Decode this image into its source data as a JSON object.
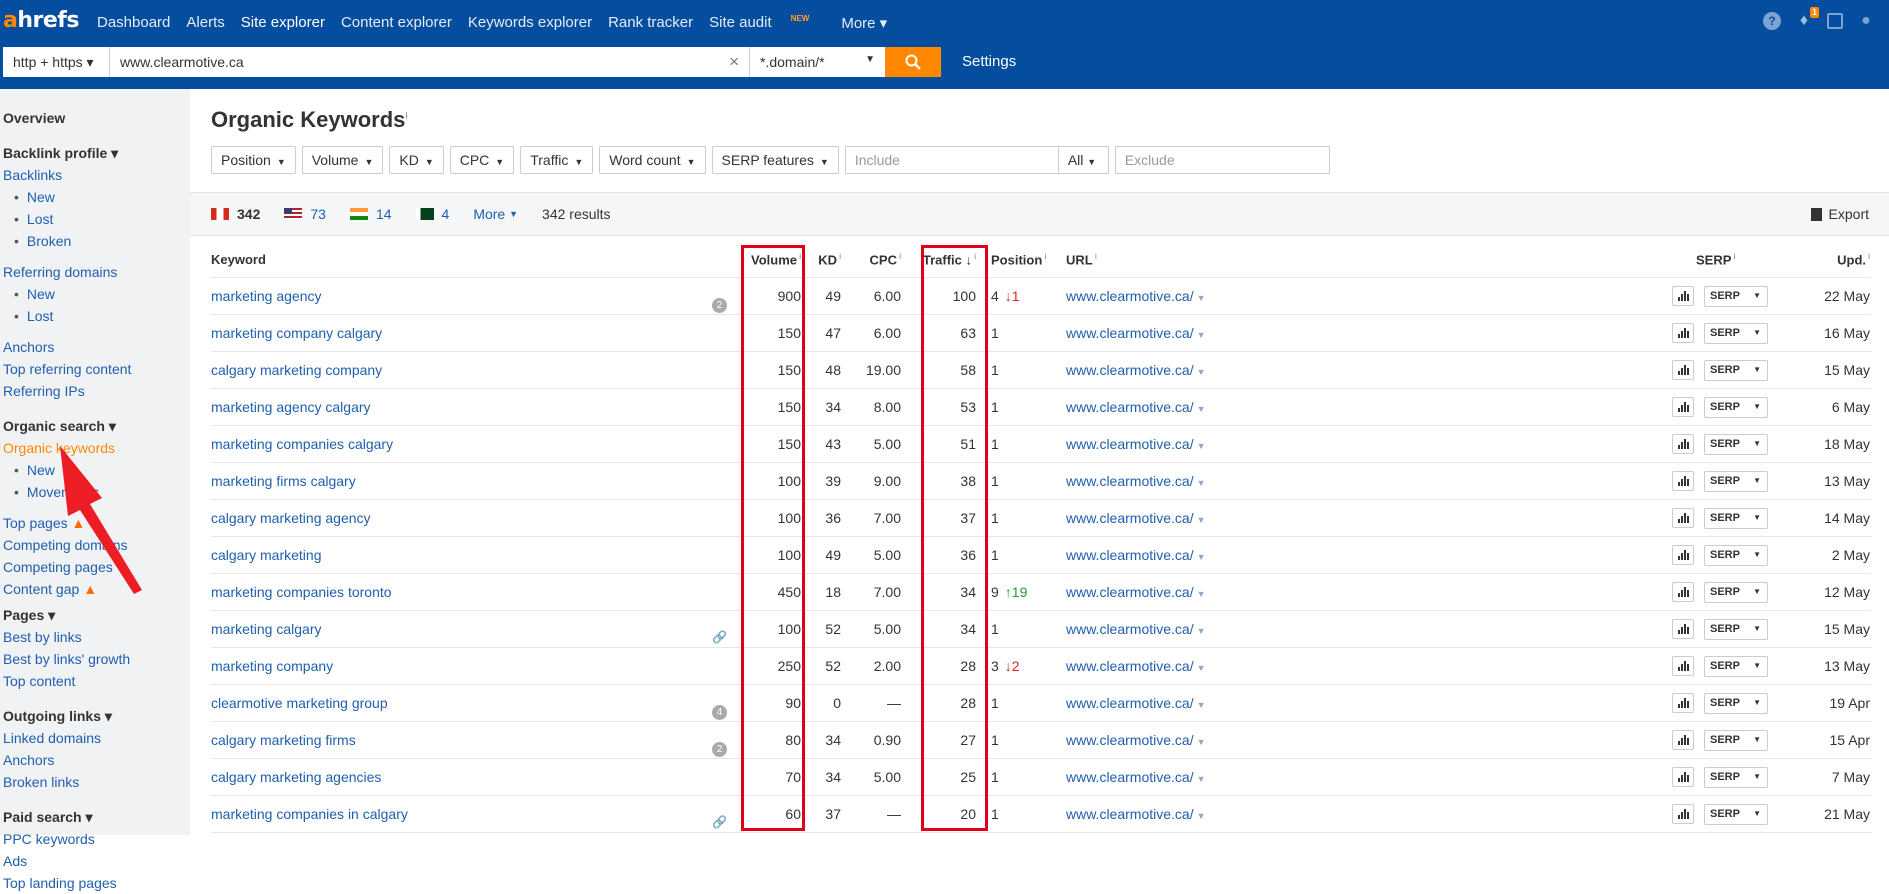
{
  "logo": {
    "a": "a",
    "rest": "hrefs"
  },
  "nav": [
    {
      "label": "Dashboard"
    },
    {
      "label": "Alerts"
    },
    {
      "label": "Site explorer"
    },
    {
      "label": "Content explorer"
    },
    {
      "label": "Keywords explorer"
    },
    {
      "label": "Rank tracker"
    },
    {
      "label": "Site audit"
    },
    {
      "label": "More ▾"
    }
  ],
  "nav_new_badge": "NEW",
  "notif_count": "1",
  "search": {
    "protocol": "http + https ▾",
    "url": "www.clearmotive.ca",
    "mode": "*.domain/*",
    "settings": "Settings"
  },
  "sidebar": {
    "overview": "Overview",
    "backlink_profile": "Backlink profile ▾",
    "backlinks": "Backlinks",
    "bl_new": "New",
    "bl_lost": "Lost",
    "bl_broken": "Broken",
    "referring_domains": "Referring domains",
    "rd_new": "New",
    "rd_lost": "Lost",
    "anchors": "Anchors",
    "top_referring": "Top referring content",
    "referring_ips": "Referring IPs",
    "organic_search": "Organic search ▾",
    "organic_keywords": "Organic keywords",
    "ok_new": "New",
    "ok_movements": "Movements",
    "top_pages": "Top pages",
    "competing_domains": "Competing domains",
    "competing_pages": "Competing pages",
    "content_gap": "Content gap",
    "pages": "Pages ▾",
    "best_by_links": "Best by links",
    "best_by_growth": "Best by links' growth",
    "top_content": "Top content",
    "outgoing_links": "Outgoing links ▾",
    "linked_domains": "Linked domains",
    "out_anchors": "Anchors",
    "broken_links": "Broken links",
    "paid_search": "Paid search ▾",
    "ppc_keywords": "PPC keywords",
    "ads": "Ads",
    "top_landing": "Top landing pages"
  },
  "page_title": "Organic Keywords",
  "page_title_info": "i",
  "filters": {
    "position": "Position",
    "volume": "Volume",
    "kd": "KD",
    "cpc": "CPC",
    "traffic": "Traffic",
    "word_count": "Word count",
    "serp_features": "SERP features",
    "include_ph": "Include",
    "all": "All",
    "exclude_ph": "Exclude"
  },
  "countries": [
    {
      "code": "CA",
      "count": "342"
    },
    {
      "code": "US",
      "count": "73"
    },
    {
      "code": "IN",
      "count": "14"
    },
    {
      "code": "PK",
      "count": "4"
    }
  ],
  "more": "More",
  "results": "342 results",
  "export": "Export",
  "columns": {
    "keyword": "Keyword",
    "volume": "Volume",
    "kd": "KD",
    "cpc": "CPC",
    "traffic": "Traffic",
    "position": "Position",
    "url": "URL",
    "serp": "SERP",
    "upd": "Upd."
  },
  "rows": [
    {
      "kw": "marketing agency",
      "icon": "2",
      "vol": "900",
      "kd": "49",
      "cpc": "6.00",
      "traffic": "100",
      "pos": "4",
      "chg": "↓1",
      "dir": "down",
      "url": "www.clearmotive.ca/",
      "upd": "22 May"
    },
    {
      "kw": "marketing company calgary",
      "icon": "",
      "vol": "150",
      "kd": "47",
      "cpc": "6.00",
      "traffic": "63",
      "pos": "1",
      "chg": "",
      "dir": "",
      "url": "www.clearmotive.ca/",
      "upd": "16 May"
    },
    {
      "kw": "calgary marketing company",
      "icon": "",
      "vol": "150",
      "kd": "48",
      "cpc": "19.00",
      "traffic": "58",
      "pos": "1",
      "chg": "",
      "dir": "",
      "url": "www.clearmotive.ca/",
      "upd": "15 May"
    },
    {
      "kw": "marketing agency calgary",
      "icon": "",
      "vol": "150",
      "kd": "34",
      "cpc": "8.00",
      "traffic": "53",
      "pos": "1",
      "chg": "",
      "dir": "",
      "url": "www.clearmotive.ca/",
      "upd": "6 May"
    },
    {
      "kw": "marketing companies calgary",
      "icon": "",
      "vol": "150",
      "kd": "43",
      "cpc": "5.00",
      "traffic": "51",
      "pos": "1",
      "chg": "",
      "dir": "",
      "url": "www.clearmotive.ca/",
      "upd": "18 May"
    },
    {
      "kw": "marketing firms calgary",
      "icon": "",
      "vol": "100",
      "kd": "39",
      "cpc": "9.00",
      "traffic": "38",
      "pos": "1",
      "chg": "",
      "dir": "",
      "url": "www.clearmotive.ca/",
      "upd": "13 May"
    },
    {
      "kw": "calgary marketing agency",
      "icon": "",
      "vol": "100",
      "kd": "36",
      "cpc": "7.00",
      "traffic": "37",
      "pos": "1",
      "chg": "",
      "dir": "",
      "url": "www.clearmotive.ca/",
      "upd": "14 May"
    },
    {
      "kw": "calgary marketing",
      "icon": "",
      "vol": "100",
      "kd": "49",
      "cpc": "5.00",
      "traffic": "36",
      "pos": "1",
      "chg": "",
      "dir": "",
      "url": "www.clearmotive.ca/",
      "upd": "2 May"
    },
    {
      "kw": "marketing companies toronto",
      "icon": "",
      "vol": "450",
      "kd": "18",
      "cpc": "7.00",
      "traffic": "34",
      "pos": "9",
      "chg": "↑19",
      "dir": "up",
      "url": "www.clearmotive.ca/",
      "upd": "12 May"
    },
    {
      "kw": "marketing calgary",
      "icon": "link",
      "vol": "100",
      "kd": "52",
      "cpc": "5.00",
      "traffic": "34",
      "pos": "1",
      "chg": "",
      "dir": "",
      "url": "www.clearmotive.ca/",
      "upd": "15 May"
    },
    {
      "kw": "marketing company",
      "icon": "",
      "vol": "250",
      "kd": "52",
      "cpc": "2.00",
      "traffic": "28",
      "pos": "3",
      "chg": "↓2",
      "dir": "down",
      "url": "www.clearmotive.ca/",
      "upd": "13 May"
    },
    {
      "kw": "clearmotive marketing group",
      "icon": "4",
      "vol": "90",
      "kd": "0",
      "cpc": "—",
      "traffic": "28",
      "pos": "1",
      "chg": "",
      "dir": "",
      "url": "www.clearmotive.ca/",
      "upd": "19 Apr"
    },
    {
      "kw": "calgary marketing firms",
      "icon": "2",
      "vol": "80",
      "kd": "34",
      "cpc": "0.90",
      "traffic": "27",
      "pos": "1",
      "chg": "",
      "dir": "",
      "url": "www.clearmotive.ca/",
      "upd": "15 Apr"
    },
    {
      "kw": "calgary marketing agencies",
      "icon": "",
      "vol": "70",
      "kd": "34",
      "cpc": "5.00",
      "traffic": "25",
      "pos": "1",
      "chg": "",
      "dir": "",
      "url": "www.clearmotive.ca/",
      "upd": "7 May"
    },
    {
      "kw": "marketing companies in calgary",
      "icon": "link",
      "vol": "60",
      "kd": "37",
      "cpc": "—",
      "traffic": "20",
      "pos": "1",
      "chg": "",
      "dir": "",
      "url": "www.clearmotive.ca/",
      "upd": "21 May"
    }
  ],
  "serp_label": "SERP",
  "colors": {
    "header": "#054d9e",
    "accent": "#ff8800",
    "link": "#1f5fae",
    "highlight": "#e0001a"
  }
}
